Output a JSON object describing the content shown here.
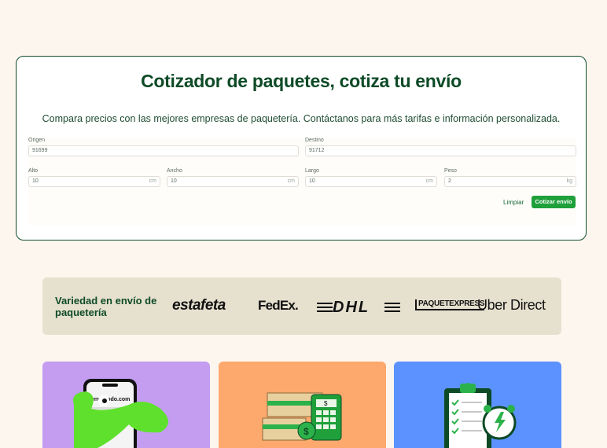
{
  "quote": {
    "title": "Cotizador de paquetes, cotiza tu envío",
    "subtitle": "Compara precios con las mejores empresas de paquetería. Contáctanos para más tarifas e información personalizada.",
    "origin_label": "Origen",
    "origin_value": "91699",
    "destination_label": "Destino",
    "destination_value": "91712",
    "height_label": "Alto",
    "height_value": "10",
    "width_label": "Ancho",
    "width_value": "10",
    "length_label": "Largo",
    "length_value": "10",
    "weight_label": "Peso",
    "weight_value": "2",
    "unit_cm": "cm",
    "unit_kg": "kg",
    "clear_label": "Limpiar",
    "submit_label": "Cotizar envío"
  },
  "carriers": {
    "title": "Variedad en envío de paquetería",
    "logos": [
      "estafeta",
      "FedEx.",
      "DHL",
      "PAQUETEXPRESS",
      "Uber Direct"
    ]
  },
  "colors": {
    "brand_green": "#0d4a26",
    "accent_green": "#1fa03b",
    "page_bg": "#fdf6ef",
    "tile_purple": "#c49cf0",
    "tile_orange": "#fda96d",
    "tile_blue": "#5b92ff"
  },
  "tiles": {
    "phone_brand": "enviatodo.com",
    "phone_icon": "phone-mascot-illustration",
    "packages_icon": "packages-calculator-illustration",
    "checklist_icon": "clipboard-clock-illustration"
  }
}
